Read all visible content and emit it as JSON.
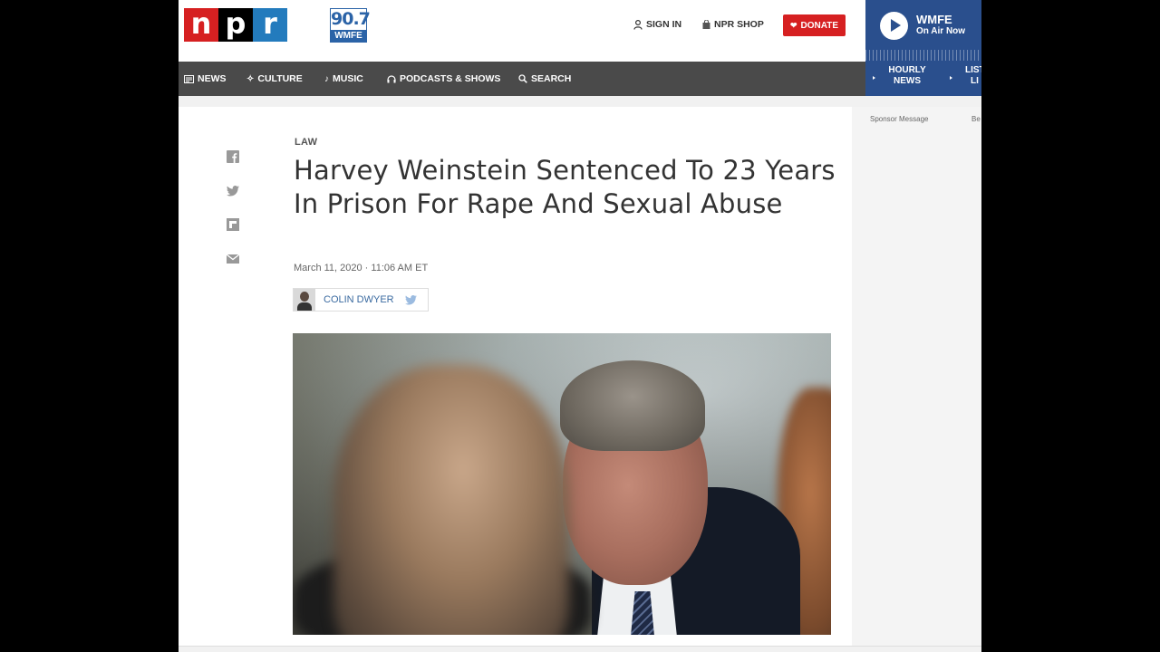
{
  "header": {
    "logo_letters": [
      "n",
      "p",
      "r"
    ],
    "station_logo": {
      "number": "90.7",
      "call_sign": "WMFE"
    },
    "sign_in": "SIGN IN",
    "shop": "NPR SHOP",
    "donate": "DONATE"
  },
  "player": {
    "station": "WMFE",
    "status": "On Air Now",
    "hourly_news_line1": "HOURLY",
    "hourly_news_line2": "NEWS",
    "listen_live_line1": "LIST",
    "listen_live_line2": "LI"
  },
  "nav": {
    "items": [
      {
        "label": "NEWS",
        "icon": "news-icon"
      },
      {
        "label": "CULTURE",
        "icon": "culture-icon"
      },
      {
        "label": "MUSIC",
        "icon": "music-icon"
      },
      {
        "label": "PODCASTS & SHOWS",
        "icon": "headphones-icon"
      },
      {
        "label": "SEARCH",
        "icon": "search-icon"
      }
    ]
  },
  "article": {
    "slug": "LAW",
    "headline": "Harvey Weinstein Sentenced To 23 Years In Prison For Rape And Sexual Abuse",
    "dateline": "March 11, 2020 · 11:06 AM ET",
    "author": "COLIN DWYER",
    "share_icons": [
      "facebook-icon",
      "twitter-icon",
      "flipboard-icon",
      "email-icon"
    ]
  },
  "sidebar": {
    "sponsor_label": "Sponsor Message",
    "sponsor_label_right": "Be"
  },
  "colors": {
    "npr_red": "#d62021",
    "npr_blue": "#237bbd",
    "nav_bg": "#4a4a4a",
    "player_bg": "#2a4f8d",
    "donate_bg": "#d62021"
  }
}
